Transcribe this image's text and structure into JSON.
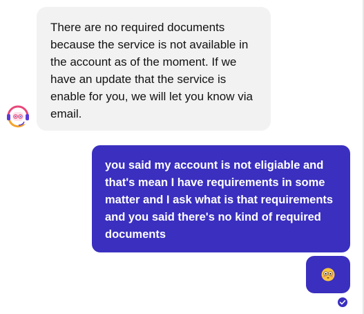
{
  "conversation": {
    "incoming": {
      "sender_icon": "support-agent-headset-icon",
      "text": "There are no required documents because the service is not available in the account as of the moment. If we have an update that the service is enable for you, we will let you know via email."
    },
    "outgoing": [
      {
        "text": "you said my account is not eligiable and that's mean I have requirements in some matter and I ask what is that requirements and you said there's no kind of required documents"
      },
      {
        "emoji_icon": "flushed-face-emoji-icon"
      }
    ],
    "status_icon": "read-check-icon"
  },
  "colors": {
    "incoming_bubble": "#f2f2f2",
    "outgoing_bubble": "#3a2fbf",
    "avatar_ring": "#e8477a"
  }
}
